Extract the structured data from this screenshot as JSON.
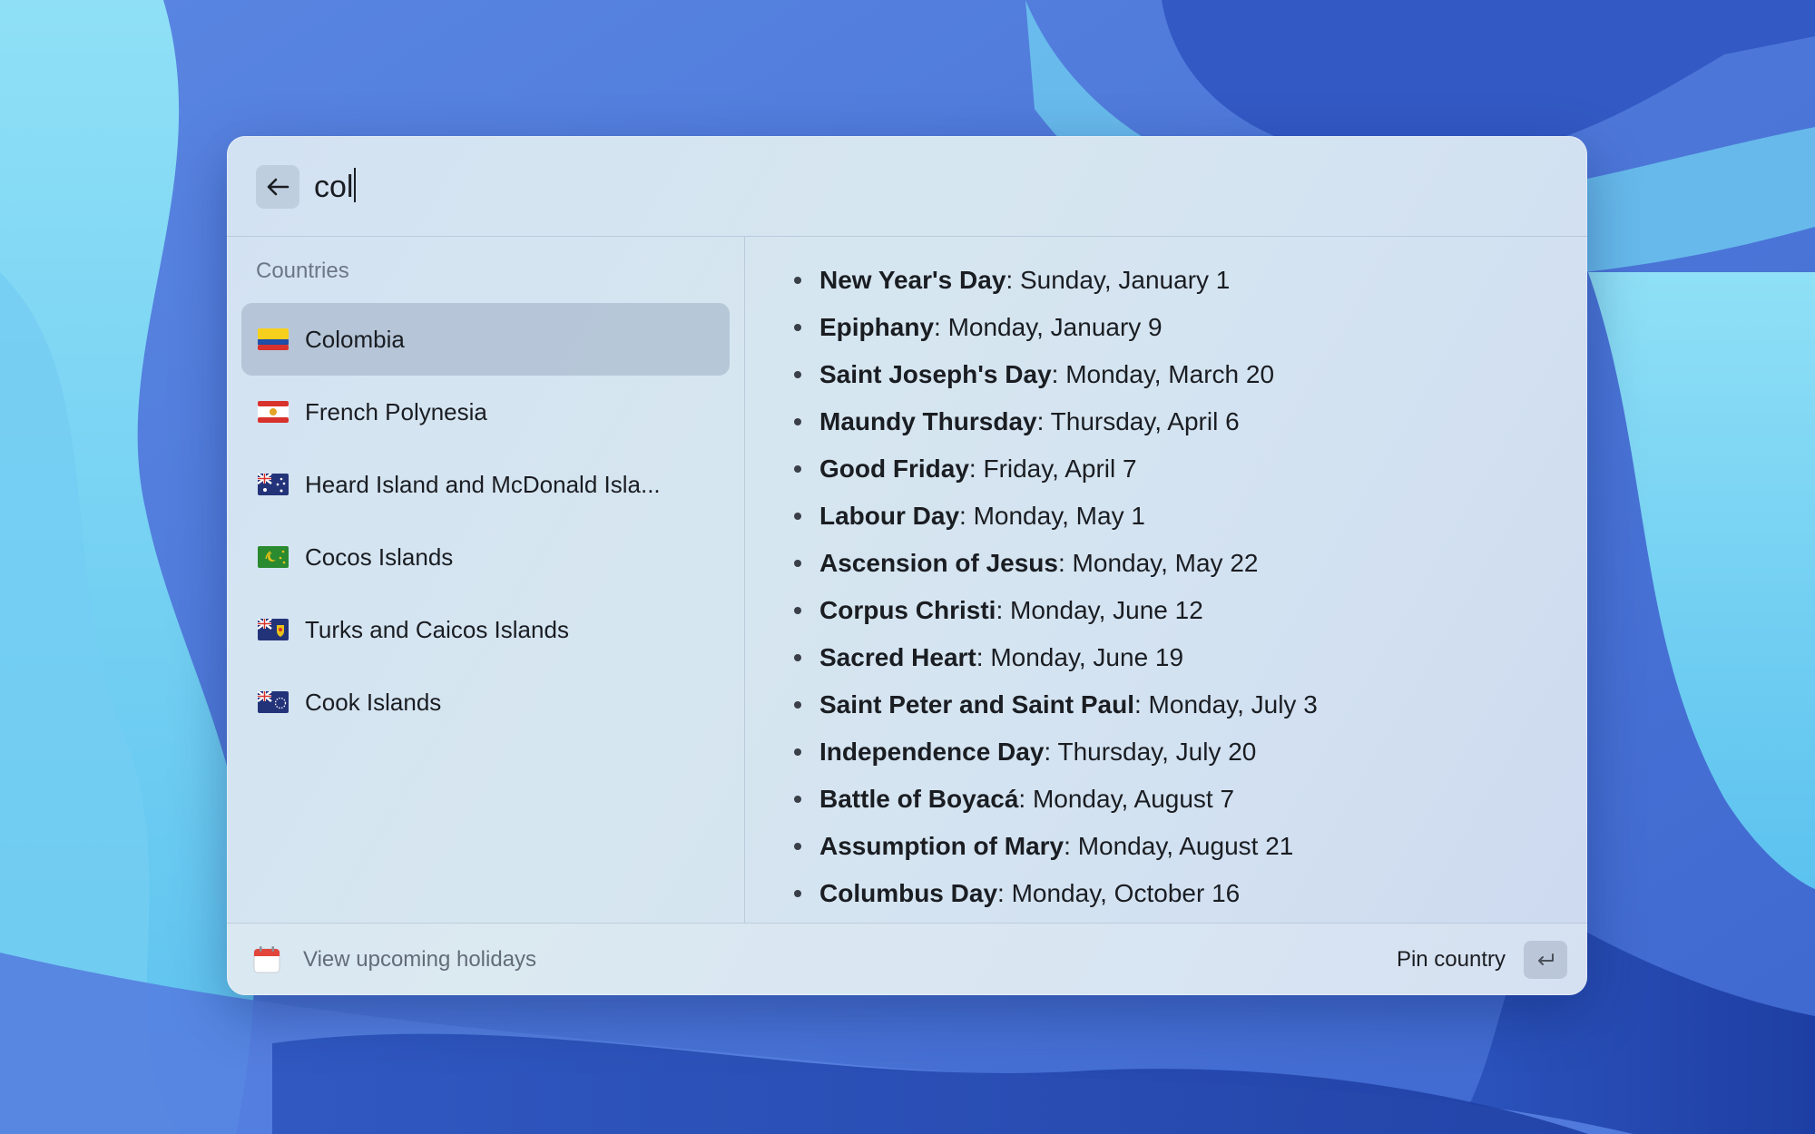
{
  "search": {
    "query": "col"
  },
  "list": {
    "section_title": "Countries",
    "items": [
      {
        "flag_icon": "colombia-flag-icon",
        "name": "Colombia",
        "selected": true
      },
      {
        "flag_icon": "french-polynesia-flag-icon",
        "name": "French Polynesia",
        "selected": false
      },
      {
        "flag_icon": "australia-flag-icon",
        "name": "Heard Island and McDonald Isla...",
        "selected": false
      },
      {
        "flag_icon": "cocos-islands-flag-icon",
        "name": "Cocos Islands",
        "selected": false
      },
      {
        "flag_icon": "turks-and-caicos-flag-icon",
        "name": "Turks and Caicos Islands",
        "selected": false
      },
      {
        "flag_icon": "cook-islands-flag-icon",
        "name": "Cook Islands",
        "selected": false
      }
    ]
  },
  "detail": {
    "holidays": [
      {
        "name": "New Year's Day",
        "date": ": Sunday, January 1"
      },
      {
        "name": "Epiphany",
        "date": ": Monday, January 9"
      },
      {
        "name": "Saint Joseph's Day",
        "date": ": Monday, March 20"
      },
      {
        "name": "Maundy Thursday",
        "date": ": Thursday, April 6"
      },
      {
        "name": "Good Friday",
        "date": ": Friday, April 7"
      },
      {
        "name": "Labour Day",
        "date": ": Monday, May 1"
      },
      {
        "name": "Ascension of Jesus",
        "date": ": Monday, May 22"
      },
      {
        "name": "Corpus Christi",
        "date": ": Monday, June 12"
      },
      {
        "name": "Sacred Heart",
        "date": ": Monday, June 19"
      },
      {
        "name": "Saint Peter and Saint Paul",
        "date": ": Monday, July 3"
      },
      {
        "name": "Independence Day",
        "date": ": Thursday, July 20"
      },
      {
        "name": "Battle of Boyacá",
        "date": ": Monday, August 7"
      },
      {
        "name": "Assumption of Mary",
        "date": ": Monday, August 21"
      },
      {
        "name": "Columbus Day",
        "date": ": Monday, October 16"
      }
    ]
  },
  "footer": {
    "icon": "calendar-icon",
    "title": "View upcoming holidays",
    "action_label": "Pin country",
    "action_key_icon": "return-key-icon"
  },
  "colors": {
    "wallpaper_base": "#4a78d8",
    "selection": "#b9c7d6",
    "text": "#1a1d22",
    "muted_text": "#6c7686"
  }
}
